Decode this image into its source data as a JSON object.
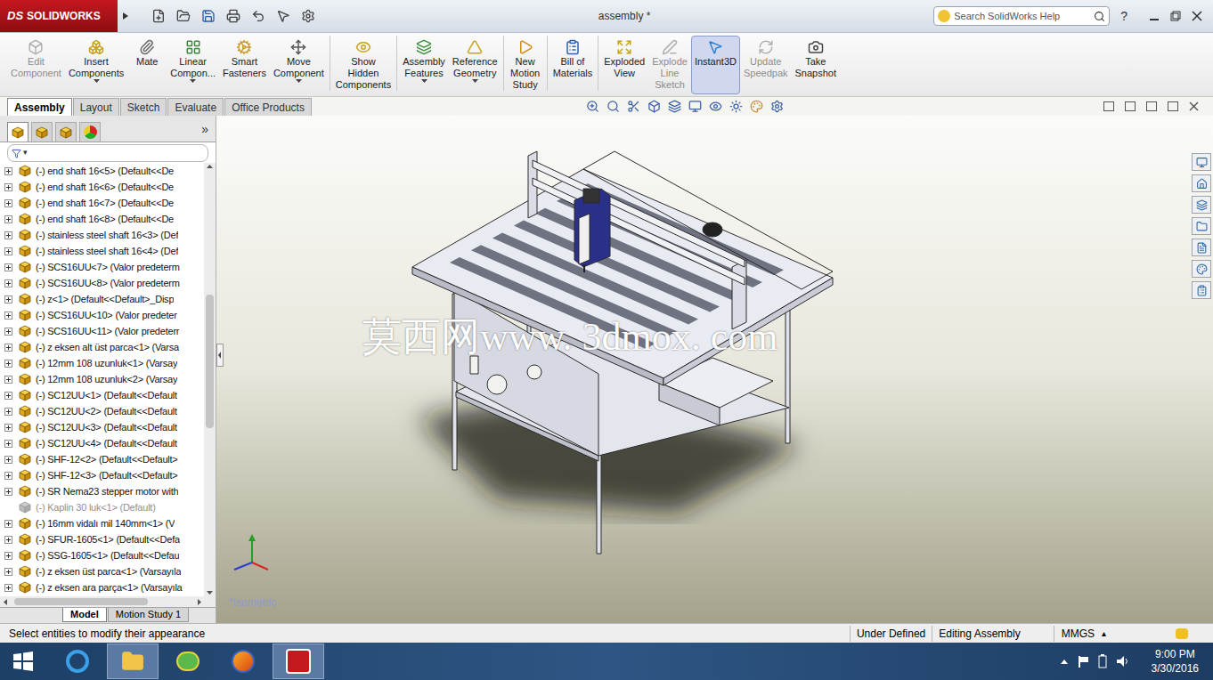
{
  "window": {
    "logo_mark": "DS",
    "app": "SOLIDWORKS",
    "title": "assembly *",
    "search_placeholder": "Search SolidWorks Help",
    "help": "?"
  },
  "ribbon": [
    {
      "lines": [
        "Edit",
        "Component"
      ],
      "disabled": true,
      "selected": false,
      "dropdown": false,
      "separator_before": false
    },
    {
      "lines": [
        "Insert",
        "Components"
      ],
      "disabled": false,
      "selected": false,
      "dropdown": true,
      "separator_before": false
    },
    {
      "lines": [
        "Mate"
      ],
      "disabled": false,
      "selected": false,
      "dropdown": false,
      "separator_before": false
    },
    {
      "lines": [
        "Linear",
        "Compon..."
      ],
      "disabled": false,
      "selected": false,
      "dropdown": true,
      "separator_before": false
    },
    {
      "lines": [
        "Smart",
        "Fasteners"
      ],
      "disabled": false,
      "selected": false,
      "dropdown": false,
      "separator_before": false
    },
    {
      "lines": [
        "Move",
        "Component"
      ],
      "disabled": false,
      "selected": false,
      "dropdown": true,
      "separator_before": false
    },
    {
      "lines": [
        "Show",
        "Hidden",
        "Components"
      ],
      "disabled": false,
      "selected": false,
      "dropdown": false,
      "separator_before": true
    },
    {
      "lines": [
        "Assembly",
        "Features"
      ],
      "disabled": false,
      "selected": false,
      "dropdown": true,
      "separator_before": true
    },
    {
      "lines": [
        "Reference",
        "Geometry"
      ],
      "disabled": false,
      "selected": false,
      "dropdown": true,
      "separator_before": false
    },
    {
      "lines": [
        "New",
        "Motion",
        "Study"
      ],
      "disabled": false,
      "selected": false,
      "dropdown": false,
      "separator_before": true
    },
    {
      "lines": [
        "Bill of",
        "Materials"
      ],
      "disabled": false,
      "selected": false,
      "dropdown": false,
      "separator_before": true
    },
    {
      "lines": [
        "Exploded",
        "View"
      ],
      "disabled": false,
      "selected": false,
      "dropdown": false,
      "separator_before": true
    },
    {
      "lines": [
        "Explode",
        "Line",
        "Sketch"
      ],
      "disabled": true,
      "selected": false,
      "dropdown": false,
      "separator_before": false
    },
    {
      "lines": [
        "Instant3D"
      ],
      "disabled": false,
      "selected": true,
      "dropdown": false,
      "separator_before": false
    },
    {
      "lines": [
        "Update",
        "Speedpak"
      ],
      "disabled": true,
      "selected": false,
      "dropdown": false,
      "separator_before": false
    },
    {
      "lines": [
        "Take",
        "Snapshot"
      ],
      "disabled": false,
      "selected": false,
      "dropdown": false,
      "separator_before": false
    }
  ],
  "command_tabs": [
    {
      "label": "Assembly",
      "selected": true
    },
    {
      "label": "Layout",
      "selected": false
    },
    {
      "label": "Sketch",
      "selected": false
    },
    {
      "label": "Evaluate",
      "selected": false
    },
    {
      "label": "Office Products",
      "selected": false
    }
  ],
  "panel": {
    "tabs": [
      {
        "selected": true
      },
      {
        "selected": false
      },
      {
        "selected": false
      },
      {
        "selected": false
      }
    ],
    "more": "»",
    "filter_caret": "▾",
    "tree": [
      {
        "label": "(-) end shaft 16<5> (Default<<De",
        "expandable": true,
        "suppressed": false
      },
      {
        "label": "(-) end shaft 16<6> (Default<<De",
        "expandable": true,
        "suppressed": false
      },
      {
        "label": "(-) end shaft 16<7> (Default<<De",
        "expandable": true,
        "suppressed": false
      },
      {
        "label": "(-) end shaft 16<8> (Default<<De",
        "expandable": true,
        "suppressed": false
      },
      {
        "label": "(-) stainless steel shaft 16<3> (Def",
        "expandable": true,
        "suppressed": false
      },
      {
        "label": "(-) stainless steel shaft 16<4> (Def",
        "expandable": true,
        "suppressed": false
      },
      {
        "label": "(-) SCS16UU<7> (Valor predeterm",
        "expandable": true,
        "suppressed": false
      },
      {
        "label": "(-) SCS16UU<8> (Valor predeterm",
        "expandable": true,
        "suppressed": false
      },
      {
        "label": "(-) z<1> (Default<<Default>_Disp",
        "expandable": true,
        "suppressed": false
      },
      {
        "label": "(-) SCS16UU<10> (Valor predeter",
        "expandable": true,
        "suppressed": false
      },
      {
        "label": "(-) SCS16UU<11> (Valor predeterr",
        "expandable": true,
        "suppressed": false
      },
      {
        "label": "(-) z eksen alt üst parca<1> (Varsa",
        "expandable": true,
        "suppressed": false
      },
      {
        "label": "(-) 12mm 108 uzunluk<1> (Varsay",
        "expandable": true,
        "suppressed": false
      },
      {
        "label": "(-) 12mm 108 uzunluk<2> (Varsay",
        "expandable": true,
        "suppressed": false
      },
      {
        "label": "(-) SC12UU<1> (Default<<Default",
        "expandable": true,
        "suppressed": false
      },
      {
        "label": "(-) SC12UU<2> (Default<<Default",
        "expandable": true,
        "suppressed": false
      },
      {
        "label": "(-) SC12UU<3> (Default<<Default",
        "expandable": true,
        "suppressed": false
      },
      {
        "label": "(-) SC12UU<4> (Default<<Default",
        "expandable": true,
        "suppressed": false
      },
      {
        "label": "(-) SHF-12<2> (Default<<Default>",
        "expandable": true,
        "suppressed": false
      },
      {
        "label": "(-) SHF-12<3> (Default<<Default>",
        "expandable": true,
        "suppressed": false
      },
      {
        "label": "(-) SR Nema23 stepper motor with",
        "expandable": true,
        "suppressed": false
      },
      {
        "label": "(-) Kaplin 30 luk<1> (Default)",
        "expandable": false,
        "suppressed": true
      },
      {
        "label": "(-) 16mm vidalı mil 140mm<1> (V",
        "expandable": true,
        "suppressed": false
      },
      {
        "label": "(-) SFUR-1605<1> (Default<<Defa",
        "expandable": true,
        "suppressed": false
      },
      {
        "label": "(-) SSG-1605<1> (Default<<Defau",
        "expandable": true,
        "suppressed": false
      },
      {
        "label": "(-) z eksen üst parca<1> (Varsayıla",
        "expandable": true,
        "suppressed": false
      },
      {
        "label": "(-) z eksen ara parça<1> (Varsayıla",
        "expandable": true,
        "suppressed": false
      }
    ],
    "bottom_tabs": [
      {
        "label": "Model",
        "selected": true
      },
      {
        "label": "Motion Study 1",
        "selected": false
      }
    ]
  },
  "viewport": {
    "view_label": "*Isometric",
    "watermark": "莫西网www. 3dmox. com"
  },
  "status_bar": {
    "message": "Select entities to modify their appearance",
    "fields": [
      "Under Defined",
      "Editing Assembly"
    ],
    "units": "MMGS",
    "units_caret": "▴"
  },
  "taskbar": {
    "apps": [
      {
        "selected": false
      },
      {
        "selected": true
      },
      {
        "selected": false
      },
      {
        "selected": false
      },
      {
        "selected": true
      }
    ],
    "time": "9:00 PM",
    "date": "3/30/2016"
  }
}
